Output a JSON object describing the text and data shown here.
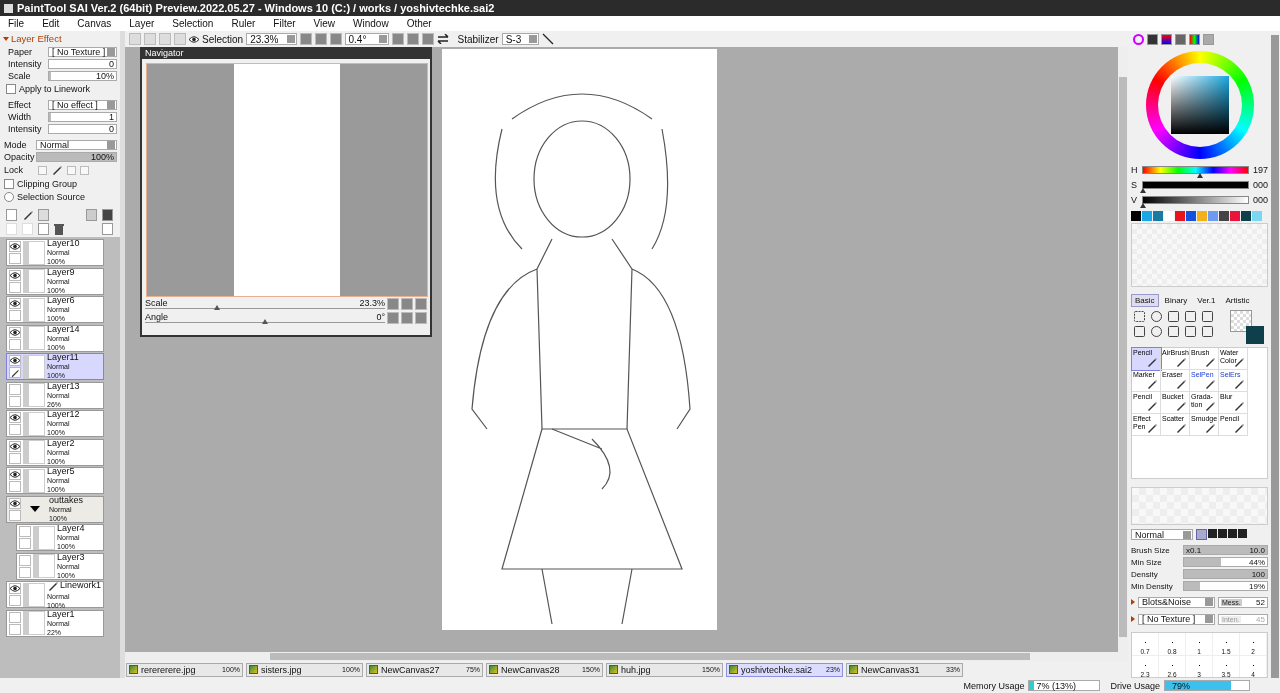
{
  "window": {
    "title": "PaintTool SAI Ver.2 (64bit) Preview.2022.05.27 - Windows 10 (C:) / works / yoshivtechke.sai2"
  },
  "menu": [
    "File",
    "Edit",
    "Canvas",
    "Layer",
    "Selection",
    "Ruler",
    "Filter",
    "View",
    "Window",
    "Other"
  ],
  "toolbar": {
    "selection_label": "Selection",
    "zoom": "23.3%",
    "angle": "0.4°",
    "stabilizer_label": "Stabilizer",
    "stabilizer": "S-3"
  },
  "layer_effect": {
    "title": "Layer Effect",
    "expanded": true,
    "paper": {
      "label": "Paper",
      "value": "[ No Texture ]"
    },
    "paper_intensity": {
      "label": "Intensity",
      "value": "0",
      "level": 0
    },
    "paper_scale": {
      "label": "Scale",
      "value": "10%",
      "level": 0.03
    },
    "apply_linework": {
      "label": "Apply to Linework",
      "checked": false
    },
    "effect": {
      "label": "Effect",
      "value": "[ No effect ]"
    },
    "effect_width": {
      "label": "Width",
      "value": "1",
      "level": 0.03
    },
    "effect_intensity": {
      "label": "Intensity",
      "value": "0",
      "level": 0
    }
  },
  "layer_props": {
    "mode": {
      "label": "Mode",
      "value": "Normal"
    },
    "opacity": {
      "label": "Opacity",
      "value": "100%",
      "level": 1
    },
    "lock_label": "Lock",
    "clipping_group": {
      "label": "Clipping Group",
      "checked": false
    },
    "selection_source": {
      "label": "Selection Source",
      "selected": false
    }
  },
  "layers": [
    {
      "kind": "layer",
      "name": "Layer10",
      "mode": "Normal",
      "opacity": "100%",
      "visible": true,
      "selected": false
    },
    {
      "kind": "layer",
      "name": "Layer9",
      "mode": "Normal",
      "opacity": "100%",
      "visible": true,
      "selected": false
    },
    {
      "kind": "layer",
      "name": "Layer6",
      "mode": "Normal",
      "opacity": "100%",
      "visible": true,
      "selected": false
    },
    {
      "kind": "layer",
      "name": "Layer14",
      "mode": "Normal",
      "opacity": "100%",
      "visible": true,
      "selected": false
    },
    {
      "kind": "layer",
      "name": "Layer11",
      "mode": "Normal",
      "opacity": "100%",
      "visible": true,
      "selected": true
    },
    {
      "kind": "layer",
      "name": "Layer13",
      "mode": "Normal",
      "opacity": "26%",
      "visible": false,
      "selected": false
    },
    {
      "kind": "layer",
      "name": "Layer12",
      "mode": "Normal",
      "opacity": "100%",
      "visible": true,
      "selected": false
    },
    {
      "kind": "layer",
      "name": "Layer2",
      "mode": "Normal",
      "opacity": "100%",
      "visible": true,
      "selected": false
    },
    {
      "kind": "layer",
      "name": "Layer5",
      "mode": "Normal",
      "opacity": "100%",
      "visible": true,
      "selected": false
    },
    {
      "kind": "folder",
      "name": "outtakes",
      "mode": "Normal",
      "opacity": "100%",
      "visible": true,
      "selected": false,
      "expanded": true,
      "children": [
        {
          "kind": "layer",
          "name": "Layer4",
          "mode": "Normal",
          "opacity": "100%",
          "visible": false,
          "selected": false
        },
        {
          "kind": "layer",
          "name": "Layer3",
          "mode": "Normal",
          "opacity": "100%",
          "visible": false,
          "selected": false
        }
      ]
    },
    {
      "kind": "linework",
      "name": "Linework1",
      "mode": "Normal",
      "opacity": "100%",
      "visible": true,
      "selected": false
    },
    {
      "kind": "layer",
      "name": "Layer1",
      "mode": "Normal",
      "opacity": "22%",
      "visible": false,
      "selected": false
    }
  ],
  "navigator": {
    "title": "Navigator",
    "scale": {
      "label": "Scale",
      "value": "23.3%",
      "level": 0.3
    },
    "angle": {
      "label": "Angle",
      "value": "0°",
      "level": 0.5
    }
  },
  "color": {
    "h": {
      "label": "H",
      "value": "197",
      "level": 0.547
    },
    "s": {
      "label": "S",
      "value": "000",
      "level": 0
    },
    "v": {
      "label": "V",
      "value": "000",
      "level": 0
    },
    "swatches": [
      {
        "color": "#000000"
      },
      {
        "color": "#1aa7e6"
      },
      {
        "color": "#1a7aa3"
      },
      {
        "color": "#ffffff"
      },
      {
        "color": "#e8141c"
      },
      {
        "color": "#1450e0"
      },
      {
        "color": "#f2b01a"
      },
      {
        "color": "#6e9af0"
      },
      {
        "color": "#444444"
      },
      {
        "color": "#e8143c"
      },
      {
        "color": "#0e3f4a"
      },
      {
        "color": "#7ad8f2"
      }
    ]
  },
  "tool_tabs": [
    {
      "label": "Basic",
      "selected": true
    },
    {
      "label": "Binary",
      "selected": false
    },
    {
      "label": "Ver.1",
      "selected": false
    },
    {
      "label": "Artistic",
      "selected": false
    }
  ],
  "tools": [
    {
      "label": "Pencil",
      "selected": true,
      "kind": "paint"
    },
    {
      "label": "AirBrush",
      "selected": false,
      "kind": "paint"
    },
    {
      "label": "Brush",
      "selected": false,
      "kind": "paint"
    },
    {
      "label": "Water Color",
      "selected": false,
      "kind": "paint"
    },
    {
      "label": "Marker",
      "selected": false,
      "kind": "paint"
    },
    {
      "label": "Eraser",
      "selected": false,
      "kind": "paint"
    },
    {
      "label": "SelPen",
      "selected": false,
      "kind": "selection"
    },
    {
      "label": "SelErs",
      "selected": false,
      "kind": "selection"
    },
    {
      "label": "Pencil",
      "selected": false,
      "kind": "paint"
    },
    {
      "label": "Bucket",
      "selected": false,
      "kind": "paint"
    },
    {
      "label": "Grada-tion",
      "selected": false,
      "kind": "paint"
    },
    {
      "label": "Blur",
      "selected": false,
      "kind": "paint"
    },
    {
      "label": "Effect Pen",
      "selected": false,
      "kind": "paint"
    },
    {
      "label": "Scatter",
      "selected": false,
      "kind": "paint"
    },
    {
      "label": "Smudge",
      "selected": false,
      "kind": "paint"
    },
    {
      "label": "Pencil",
      "selected": false,
      "kind": "paint"
    }
  ],
  "brush": {
    "blend": "Normal",
    "size": {
      "label": "Brush Size",
      "multiplier": "x0.1",
      "value": "10.0",
      "level": 1
    },
    "min_size": {
      "label": "Min Size",
      "value": "44%",
      "level": 0.44
    },
    "density": {
      "label": "Density",
      "value": "100",
      "level": 1
    },
    "min_density": {
      "label": "Min Density",
      "value": "19%",
      "level": 0.19
    },
    "blots": {
      "value": "Blots&Noise",
      "label": "Mess.",
      "amount": "52"
    },
    "texture": {
      "value": "[ No Texture ]",
      "label": "Inten.",
      "amount": "45",
      "disabled": true
    },
    "presets": [
      "0.7",
      "0.8",
      "1",
      "1.5",
      "2",
      "2.3",
      "2.6",
      "3",
      "3.5",
      "4"
    ]
  },
  "tabs": [
    {
      "name": "rerererere.jpg",
      "zoom": "100%",
      "selected": false
    },
    {
      "name": "sisters.jpg",
      "zoom": "100%",
      "selected": false
    },
    {
      "name": "NewCanvas27",
      "zoom": "75%",
      "selected": false
    },
    {
      "name": "NewCanvas28",
      "zoom": "150%",
      "selected": false
    },
    {
      "name": "huh.jpg",
      "zoom": "150%",
      "selected": false
    },
    {
      "name": "yoshivtechke.sai2",
      "zoom": "23%",
      "selected": true
    },
    {
      "name": "NewCanvas31",
      "zoom": "33%",
      "selected": false
    }
  ],
  "status": {
    "memory": {
      "label": "Memory Usage",
      "value": "7% (13%)",
      "level": 0.07
    },
    "drive": {
      "label": "Drive Usage",
      "value": "79%",
      "level": 0.79
    }
  }
}
